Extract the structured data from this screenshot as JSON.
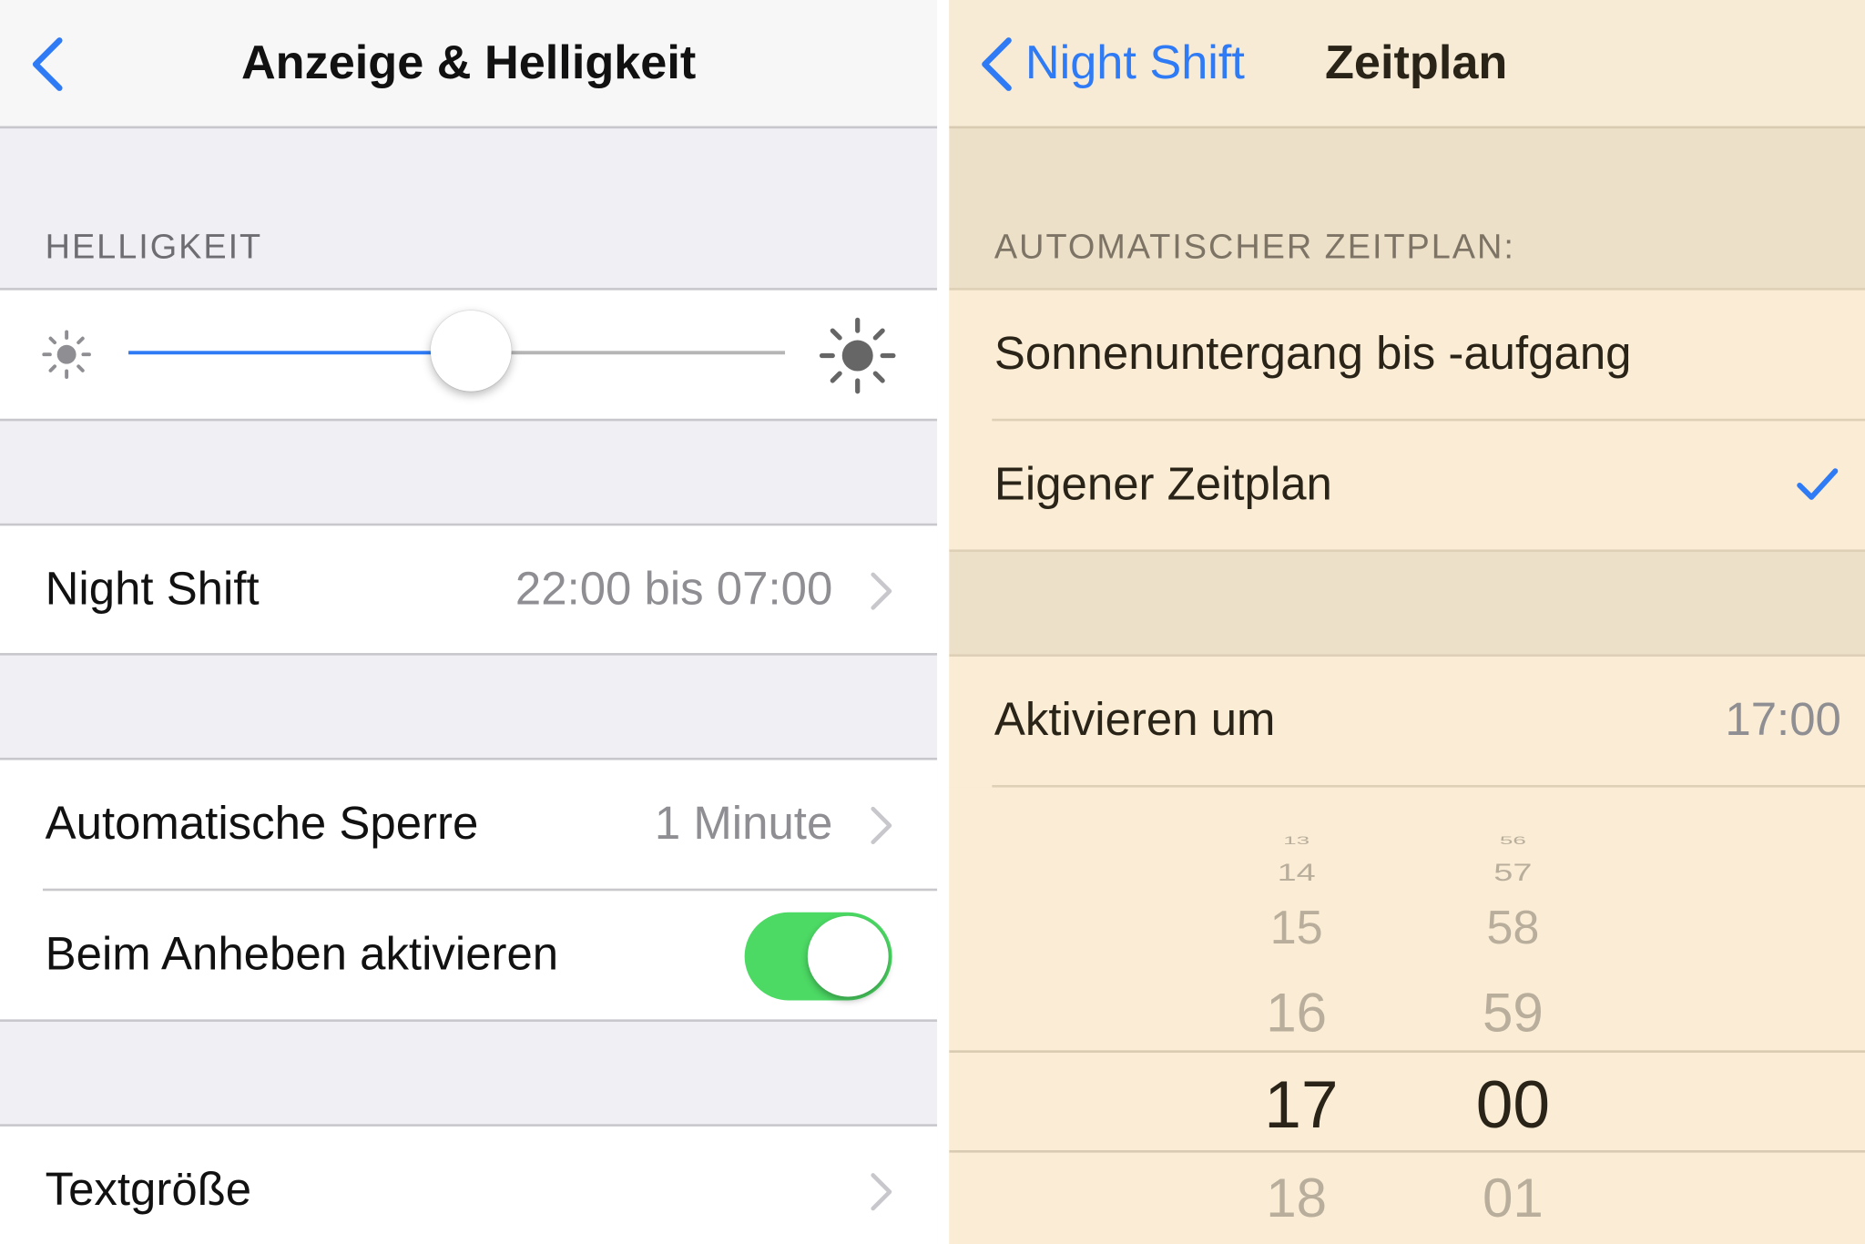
{
  "left": {
    "title": "Anzeige & Helligkeit",
    "back_icon": "chevron-left-icon",
    "brightness_header": "HELLIGKEIT",
    "brightness_level": 0.52,
    "night_shift": {
      "label": "Night Shift",
      "value": "22:00 bis 07:00"
    },
    "auto_lock": {
      "label": "Automatische Sperre",
      "value": "1 Minute"
    },
    "raise_to_wake": {
      "label": "Beim Anheben aktivieren",
      "on": true
    },
    "text_size": {
      "label": "Textgröße"
    }
  },
  "right": {
    "back_label": "Night Shift",
    "title": "Zeitplan",
    "schedule_header": "AUTOMATISCHER ZEITPLAN:",
    "option_sunset": "Sonnenuntergang bis -aufgang",
    "option_custom": "Eigener Zeitplan",
    "selected_option": "Eigener Zeitplan",
    "activate": {
      "label": "Aktivieren um",
      "value": "17:00"
    },
    "picker": {
      "hours": [
        "13",
        "14",
        "15",
        "16",
        "17",
        "18"
      ],
      "minutes": [
        "56",
        "57",
        "58",
        "59",
        "00",
        "01"
      ],
      "selected_hour": "17",
      "selected_minute": "00"
    }
  },
  "colors": {
    "accent": "#2f7bf6",
    "toggle_on": "#4cd964",
    "night_shift_tint": "#fbedd5"
  }
}
